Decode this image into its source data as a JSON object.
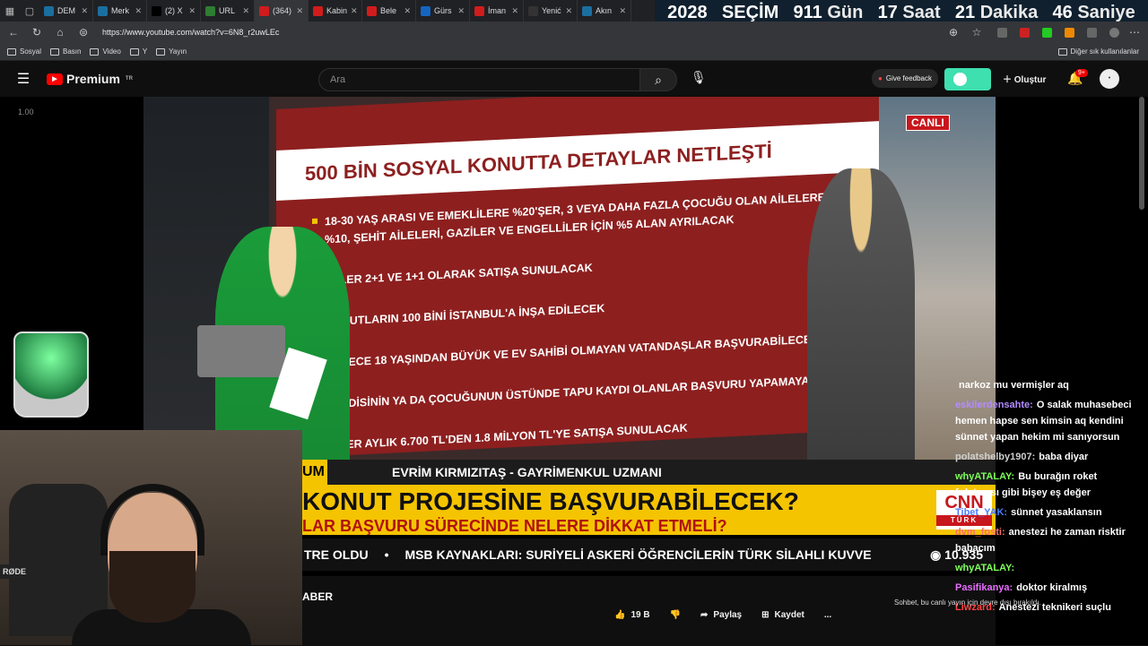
{
  "tabs": [
    {
      "label": "DEM",
      "color": "#1a6fa0"
    },
    {
      "label": "Merk",
      "color": "#1a6fa0"
    },
    {
      "label": "(2) X",
      "color": "#000000"
    },
    {
      "label": "URL",
      "color": "#2e7d32"
    },
    {
      "label": "(364)",
      "color": "#d01c1c",
      "active": true
    },
    {
      "label": "Kabin",
      "color": "#d01c1c"
    },
    {
      "label": "Bele",
      "color": "#d01c1c"
    },
    {
      "label": "Gürs",
      "color": "#1565c0"
    },
    {
      "label": "İman",
      "color": "#d01c1c"
    },
    {
      "label": "Yenić",
      "color": "#333333"
    },
    {
      "label": "Akın",
      "color": "#1a6fa0"
    }
  ],
  "countdown": {
    "year": "2028",
    "election": "SEÇİM",
    "days": "911",
    "days_lbl": "Gün",
    "hours": "17",
    "hours_lbl": "Saat",
    "minutes": "21",
    "minutes_lbl": "Dakika",
    "seconds": "46",
    "seconds_lbl": "Saniye"
  },
  "address": {
    "url": "https://www.youtube.com/watch?v=6N8_r2uwLEc"
  },
  "bookmarks": {
    "items": [
      "Sosyal",
      "Basın",
      "Video",
      "Y",
      "Yayın"
    ],
    "other": "Diğer sık kullanılanlar"
  },
  "youtube": {
    "brand": "Premium",
    "region": "TR",
    "search_placeholder": "Ara",
    "give_feedback": "Give feedback",
    "create": "Oluştur",
    "notif_count": "9+",
    "toggle_color": "#3ee0b0"
  },
  "player": {
    "zoom": "1.00"
  },
  "video": {
    "board_title": "500 BİN SOSYAL KONUTTA DETAYLAR NETLEŞTİ",
    "bullets": [
      "18-30 YAŞ ARASI VE EMEKLİLERE %20'ŞER, 3 VEYA DAHA FAZLA ÇOCUĞU OLAN AİLELERE %10, ŞEHİT AİLELERİ, GAZİLER VE ENGELLİLER İÇİN %5 ALAN AYRILACAK",
      "EVLER 2+1 VE 1+1 OLARAK SATIŞA SUNULACAK",
      "KONUTLARIN 100 BİNİ İSTANBUL'A İNŞA EDİLECEK",
      "SADECE 18 YAŞINDAN BÜYÜK VE EV SAHİBİ OLMAYAN VATANDAŞLAR BAŞVURABİLECEK",
      "KENDİSİNİN YA DA ÇOCUĞUNUN ÜSTÜNDE TAPU KAYDI OLANLAR BAŞVURU YAPAMAYACAK",
      "EVLER AYLIK 6.700 TL'DEN 1.8 MİLYON TL'YE SATIŞA SUNULACAK"
    ],
    "live": "CANLI",
    "um": "UM",
    "guest": "EVRİM KIRMIZITAŞ - GAYRİMENKUL UZMANI",
    "headline": "KONUT PROJESİNE BAŞVURABİLECEK?",
    "subline": "LAR BAŞVURU SÜRECİNDE NELERE DİKKAT ETMELİ?",
    "cnn_logo": "CNN",
    "cnn_sub": "TÜRK",
    "ticker_left": "TRE OLDU",
    "ticker_main": "MSB KAYNAKLARI: SURİYELİ ASKERİ ÖĞRENCİLERİN TÜRK SİLAHLI KUVVE",
    "ticker_value": "10.935"
  },
  "webcam": {
    "mic_brand": "RØDE"
  },
  "below_video": {
    "label": "ABER",
    "likes": "19 B",
    "share": "Paylaş",
    "save": "Kaydet",
    "more": "..."
  },
  "chat": {
    "messages": [
      {
        "user": "",
        "text": "narkoz mu vermişler aq",
        "color": "#ffffff"
      },
      {
        "user": "eskilerdensahte:",
        "text": "O salak muhasebeci hemen hapse sen kimsin aq kendini sünnet yapan hekim mi sanıyorsun",
        "color": "#b48cff"
      },
      {
        "user": "polatshelby1907:",
        "text": "baba diyar",
        "color": "#cfcfcf"
      },
      {
        "user": "whyATALAY:",
        "text": "Bu burağın roket fırlatması gibi bişey eş değer",
        "color": "#7dff5a"
      },
      {
        "user": "Tibet_YAK:",
        "text": "sünnet yasaklansın",
        "color": "#4a7dff"
      },
      {
        "user": "dvm_fosti:",
        "text": "anestezi he zaman risktir babacım",
        "color": "#ff6d6d"
      },
      {
        "user": "whyATALAY:",
        "text": "",
        "color": "#7dff5a"
      },
      {
        "user": "Pasifikanya:",
        "text": "doktor kiralmış",
        "color": "#e86dff"
      },
      {
        "user": "Liwzard:",
        "text": "Anestezi teknikeri suçlu",
        "color": "#ff4444"
      }
    ],
    "disabled_notice": "Sohbet, bu canlı yayın için devre dışı bırakıldı."
  }
}
